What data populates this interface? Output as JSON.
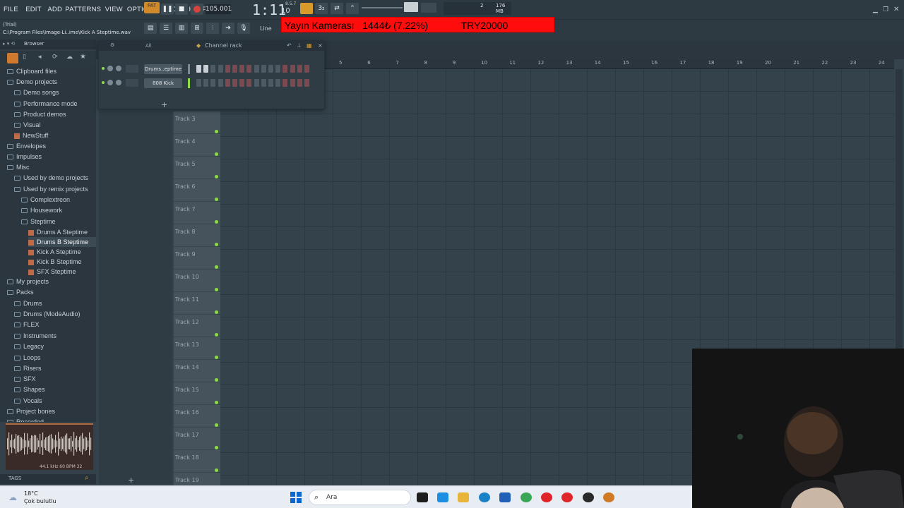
{
  "menu": [
    "FILE",
    "EDIT",
    "ADD",
    "PATTERNS",
    "VIEW",
    "OPTIONS",
    "TOOLS",
    "HELP"
  ],
  "transport": {
    "pat_label": "PAT",
    "tempo": "105.001",
    "time": "1:11",
    "time_sub": "10",
    "step": "8.5.7",
    "memory": "176 MB",
    "cpu": "2"
  },
  "status": {
    "mode": "(Trial)",
    "file": "C:\\Program Files\\Image-Li..ime\\Kick A Steptime.wav"
  },
  "snap": "Line",
  "browser_title": "Browser",
  "browser_items": [
    {
      "label": "Clipboard files",
      "kind": "folder",
      "indent": 0
    },
    {
      "label": "Demo projects",
      "kind": "folder",
      "indent": 0
    },
    {
      "label": "Demo songs",
      "kind": "folder",
      "indent": 1
    },
    {
      "label": "Performance mode",
      "kind": "folder",
      "indent": 1
    },
    {
      "label": "Product demos",
      "kind": "folder",
      "indent": 1
    },
    {
      "label": "Visual",
      "kind": "folder",
      "indent": 1
    },
    {
      "label": "NewStuff",
      "kind": "file",
      "indent": 1
    },
    {
      "label": "Envelopes",
      "kind": "folder",
      "indent": 0
    },
    {
      "label": "Impulses",
      "kind": "folder",
      "indent": 0
    },
    {
      "label": "Misc",
      "kind": "folder",
      "indent": 0
    },
    {
      "label": "Used by demo projects",
      "kind": "folder",
      "indent": 1
    },
    {
      "label": "Used by remix projects",
      "kind": "folder",
      "indent": 1
    },
    {
      "label": "Complextreon",
      "kind": "folder",
      "indent": 2
    },
    {
      "label": "Housework",
      "kind": "folder",
      "indent": 2
    },
    {
      "label": "Steptime",
      "kind": "folder",
      "indent": 2
    },
    {
      "label": "Drums A Steptime",
      "kind": "file",
      "indent": 3
    },
    {
      "label": "Drums B Steptime",
      "kind": "file",
      "indent": 3
    },
    {
      "label": "Kick A Steptime",
      "kind": "file",
      "indent": 3
    },
    {
      "label": "Kick B Steptime",
      "kind": "file",
      "indent": 3
    },
    {
      "label": "SFX Steptime",
      "kind": "file",
      "indent": 3
    },
    {
      "label": "My projects",
      "kind": "folder",
      "indent": 0
    },
    {
      "label": "Packs",
      "kind": "folder",
      "indent": 0
    },
    {
      "label": "Drums",
      "kind": "folder",
      "indent": 1
    },
    {
      "label": "Drums (ModeAudio)",
      "kind": "folder",
      "indent": 1
    },
    {
      "label": "FLEX",
      "kind": "folder",
      "indent": 1
    },
    {
      "label": "Instruments",
      "kind": "folder",
      "indent": 1
    },
    {
      "label": "Legacy",
      "kind": "folder",
      "indent": 1
    },
    {
      "label": "Loops",
      "kind": "folder",
      "indent": 1
    },
    {
      "label": "Risers",
      "kind": "folder",
      "indent": 1
    },
    {
      "label": "SFX",
      "kind": "folder",
      "indent": 1
    },
    {
      "label": "Shapes",
      "kind": "folder",
      "indent": 1
    },
    {
      "label": "Vocals",
      "kind": "folder",
      "indent": 1
    },
    {
      "label": "Project bones",
      "kind": "folder",
      "indent": 0
    },
    {
      "label": "Recorded",
      "kind": "folder",
      "indent": 0
    }
  ],
  "wave_info": "44.1 kHz 60 BPM 32",
  "tags_label": "TAGS",
  "channel_rack": {
    "title": "Channel rack",
    "filter": "All",
    "channels": [
      {
        "name": "Drums..eptime"
      },
      {
        "name": "808 Kick"
      }
    ]
  },
  "ruler": [
    "5",
    "6",
    "7",
    "8",
    "9",
    "10",
    "11",
    "12",
    "13",
    "14",
    "15",
    "16",
    "17",
    "18",
    "19",
    "20",
    "21",
    "22",
    "23",
    "24"
  ],
  "tracks": [
    "Track 3",
    "Track 4",
    "Track 5",
    "Track 6",
    "Track 7",
    "Track 8",
    "Track 9",
    "Track 10",
    "Track 11",
    "Track 12",
    "Track 13",
    "Track 14",
    "Track 15",
    "Track 16",
    "Track 17",
    "Track 18",
    "Track 19"
  ],
  "overlay": {
    "text": "Yayın Kamerası   1444₺ (7.22%)            TRY20000"
  },
  "weather": {
    "temp": "18°C",
    "desc": "Çok bulutlu"
  },
  "search_placeholder": "Ara",
  "colors": {
    "accent": "#8fdc4a",
    "overlay": "#ff0d0d",
    "file_icon": "#c06b47"
  }
}
